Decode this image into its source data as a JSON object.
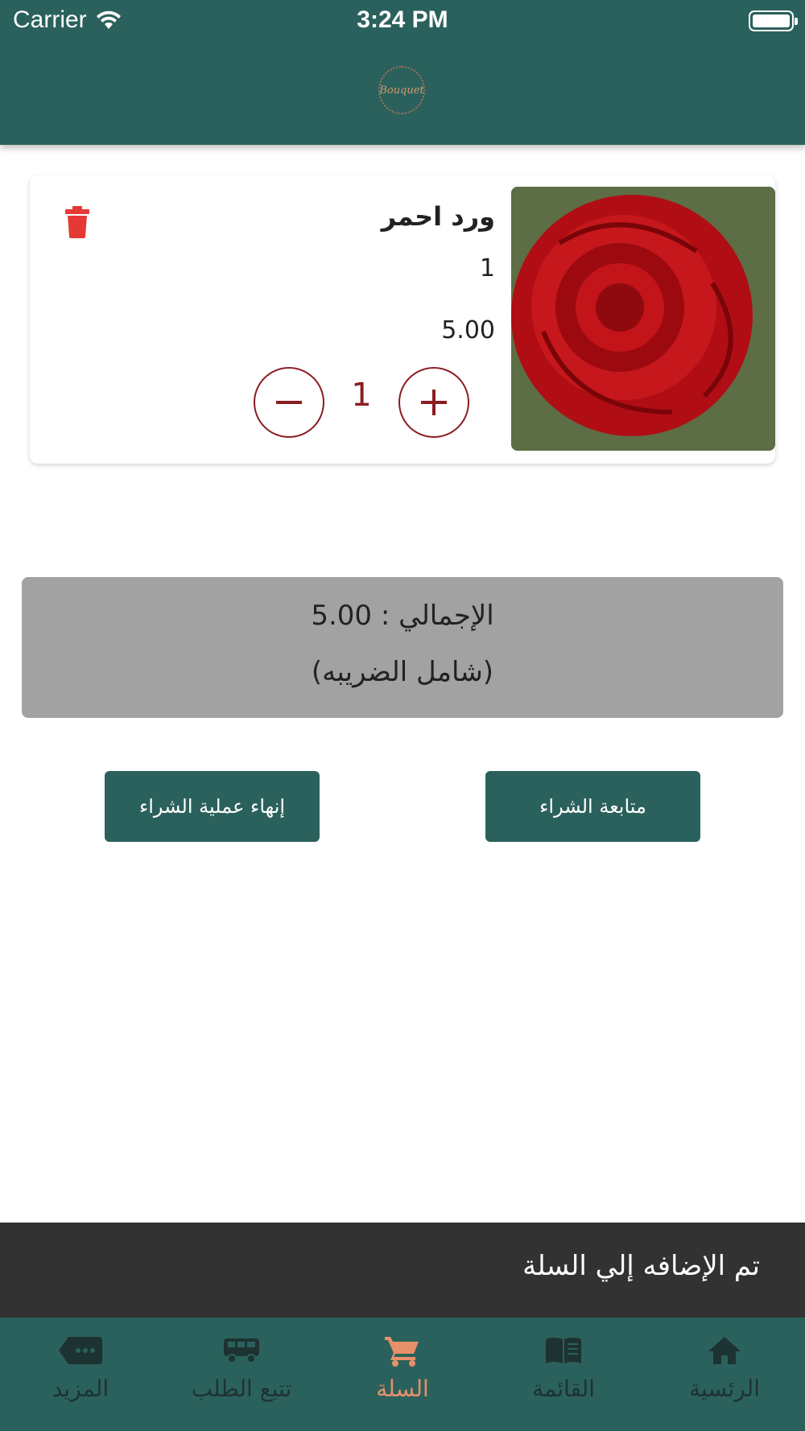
{
  "status_bar": {
    "carrier": "Carrier",
    "time": "3:24 PM"
  },
  "header": {
    "logo_text": "Bouquet"
  },
  "cart_item": {
    "name": "ورد احمر",
    "quantity_text": "1",
    "price": "5.00",
    "stepper_value": "1"
  },
  "summary": {
    "total": "الإجمالي : 5.00",
    "tax_note": "(شامل الضريبه)"
  },
  "buttons": {
    "finish": "إنهاء عملية الشراء",
    "continue": "متابعة الشراء"
  },
  "toast": {
    "message": "تم الإضافه إلي السلة"
  },
  "tabs": [
    {
      "label": "المزيد",
      "icon": "more-icon"
    },
    {
      "label": "تتبع الطلب",
      "icon": "delivery-truck-icon"
    },
    {
      "label": "السلة",
      "icon": "cart-icon",
      "active": true
    },
    {
      "label": "القائمة",
      "icon": "menu-book-icon"
    },
    {
      "label": "الرئسية",
      "icon": "home-icon"
    }
  ],
  "colors": {
    "primary": "#2b615c",
    "accent": "#e8906a",
    "delete": "#e53935",
    "stepper": "#8a1c22",
    "total_bg": "#a2a2a2",
    "toast_bg": "#323232"
  }
}
